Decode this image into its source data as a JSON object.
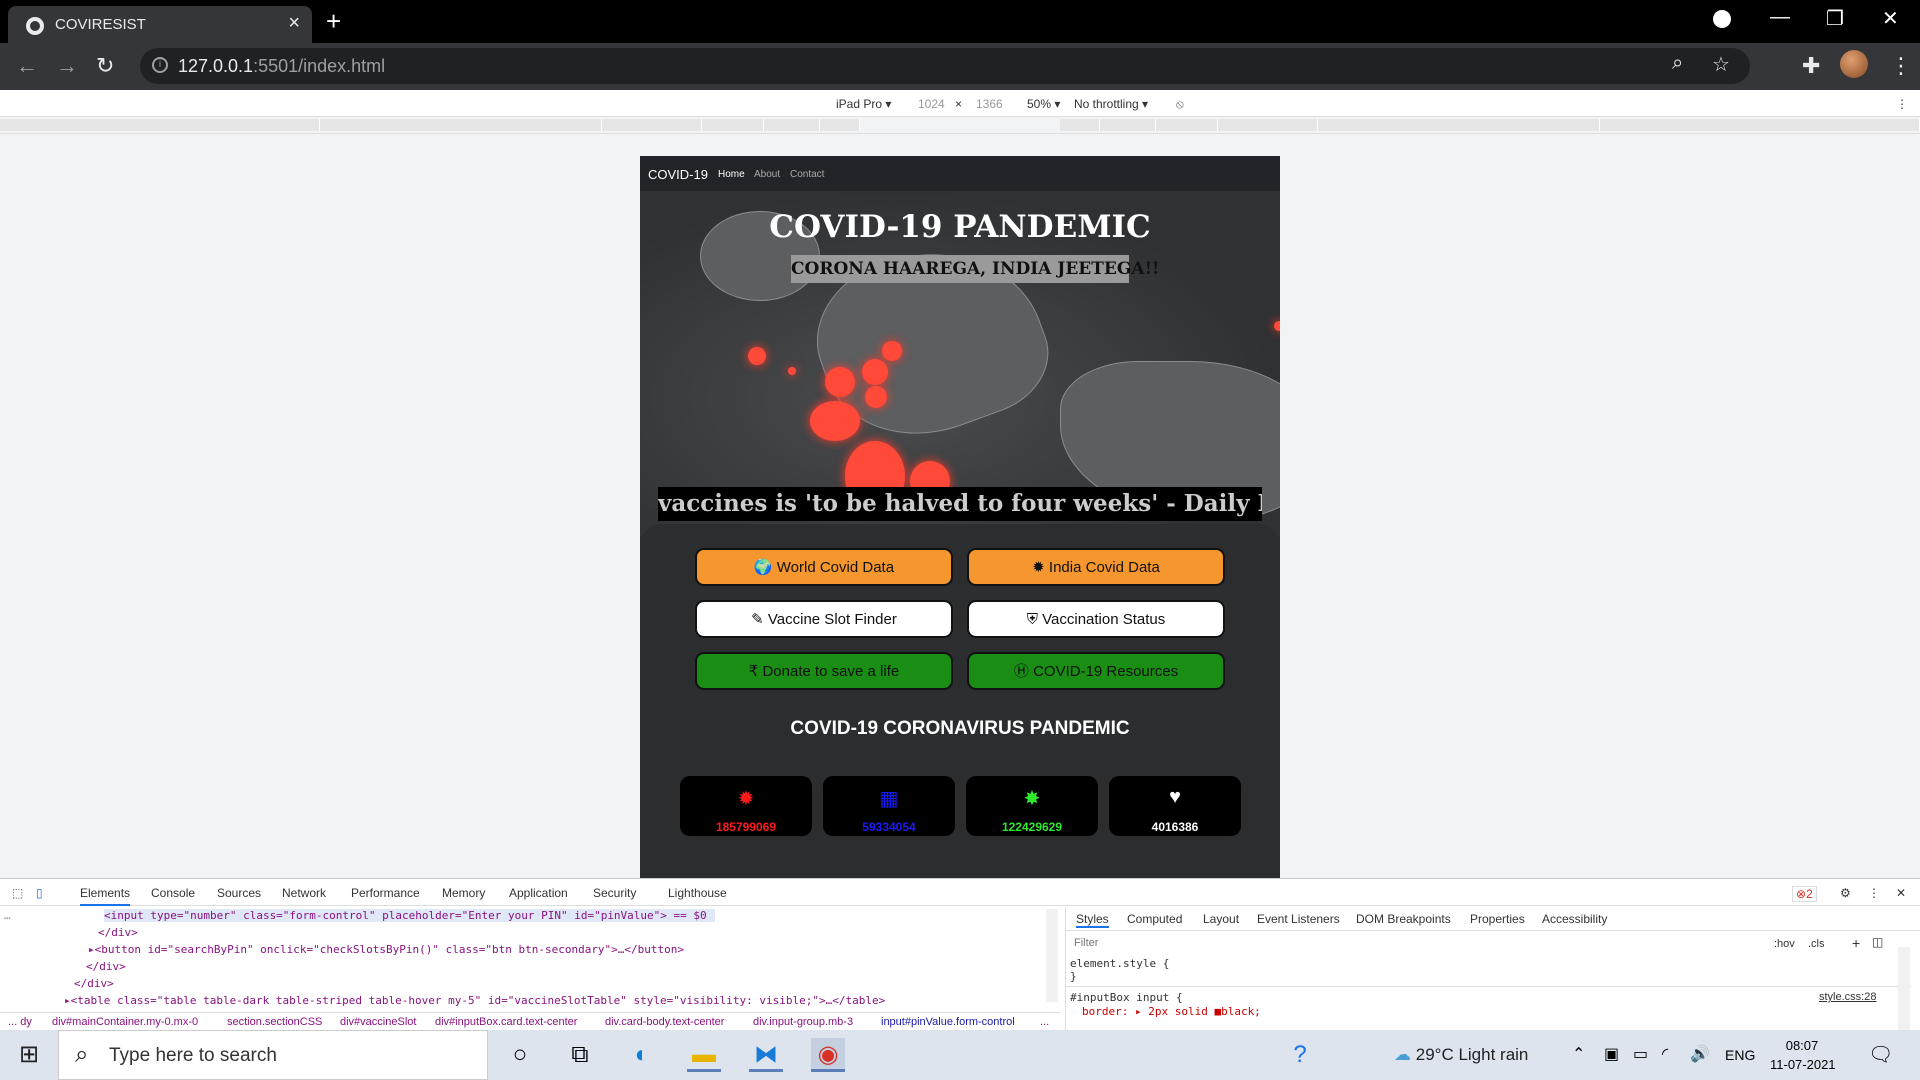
{
  "browser": {
    "tab_title": "COVIRESIST",
    "url_host": "127.0.0.1",
    "url_rest": ":5501/index.html"
  },
  "device_toolbar": {
    "device": "iPad Pro ▾",
    "width": "1024",
    "x": "×",
    "height": "1366",
    "zoom": "50% ▾",
    "throttling": "No throttling ▾"
  },
  "site": {
    "nav": {
      "brand": "COVID-19",
      "links": [
        "Home",
        "About",
        "Contact"
      ]
    },
    "hero": {
      "title": "COVID-19 PANDEMIC",
      "subtitle": "CORONA HAAREGA, INDIA JEETEGA!!",
      "marquee": "vaccines is 'to be halved to four weeks' - Daily I"
    },
    "buttons": {
      "world": "World Covid Data",
      "india": "India Covid Data",
      "slot": "Vaccine Slot Finder",
      "status": "Vaccination Status",
      "donate": "Donate to save a life",
      "resources": "COVID-19 Resources"
    },
    "section_title": "COVID-19 CORONAVIRUS PANDEMIC",
    "stats": [
      {
        "value": "185799069",
        "color": "#ff1a1a"
      },
      {
        "value": "59334054",
        "color": "#1a1aff"
      },
      {
        "value": "122429629",
        "color": "#2ee82e"
      },
      {
        "value": "4016386",
        "color": "#ffffff"
      }
    ]
  },
  "devtools": {
    "tabs": [
      "Elements",
      "Console",
      "Sources",
      "Network",
      "Performance",
      "Memory",
      "Application",
      "Security",
      "Lighthouse"
    ],
    "error_count": "2",
    "code": [
      "<input type=\"number\" class=\"form-control\" placeholder=\"Enter your PIN\" id=\"pinValue\"> == $0",
      "</div>",
      "▸<button id=\"searchByPin\" onclick=\"checkSlotsByPin()\" class=\"btn btn-secondary\">…</button>",
      "</div>",
      "</div>",
      "▸<table class=\"table table-dark table-striped table-hover my-5\" id=\"vaccineSlotTable\" style=\"visibility: visible;\">…</table>"
    ],
    "crumbs": [
      "... dy",
      "div#mainContainer.my-0.mx-0",
      "section.sectionCSS",
      "div#vaccineSlot",
      "div#inputBox.card.text-center",
      "div.card-body.text-center",
      "div.input-group.mb-3",
      "input#pinValue.form-control",
      "..."
    ],
    "style_tabs": [
      "Styles",
      "Computed",
      "Layout",
      "Event Listeners",
      "DOM Breakpoints",
      "Properties",
      "Accessibility"
    ],
    "filter_placeholder": "Filter",
    "hov": ":hov",
    "cls": ".cls",
    "rule1_selector": "element.style {",
    "rule1_close": "}",
    "rule2_selector": "#inputBox input {",
    "rule2_prop": "border: ▸ 2px solid ■black;",
    "rule2_source": "style.css:28"
  },
  "taskbar": {
    "search_placeholder": "Type here to search",
    "weather": "29°C  Light rain",
    "lang": "ENG",
    "time": "08:07",
    "date": "11-07-2021"
  }
}
